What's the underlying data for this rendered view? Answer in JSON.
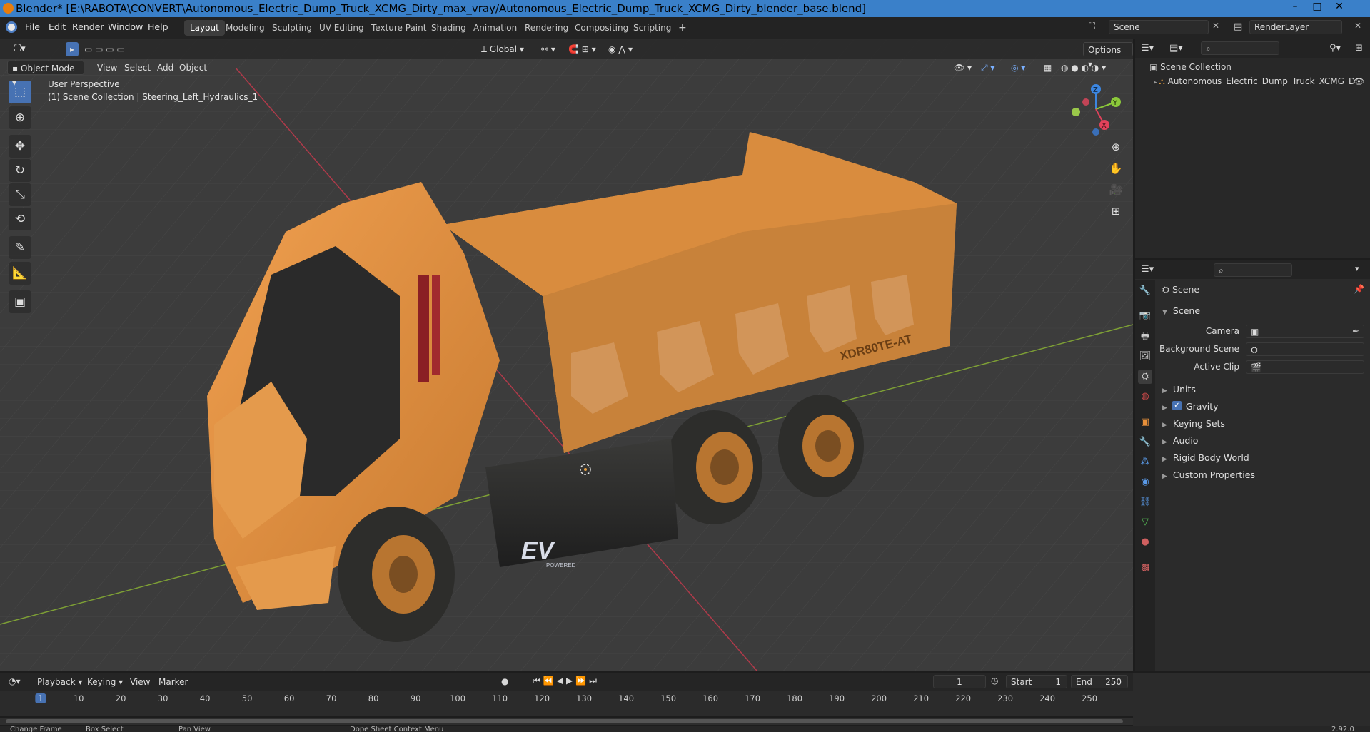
{
  "window": {
    "title": "Blender* [E:\\RABOTA\\CONVERT\\Autonomous_Electric_Dump_Truck_XCMG_Dirty_max_vray/Autonomous_Electric_Dump_Truck_XCMG_Dirty_blender_base.blend]",
    "controls": {
      "minimize": "–",
      "maximize": "□",
      "close": "✕"
    }
  },
  "menubar": {
    "items": [
      "File",
      "Edit",
      "Render",
      "Window",
      "Help"
    ]
  },
  "workspaces": {
    "tabs": [
      "Layout",
      "Modeling",
      "Sculpting",
      "UV Editing",
      "Texture Paint",
      "Shading",
      "Animation",
      "Rendering",
      "Compositing",
      "Scripting"
    ],
    "active": "Layout",
    "add": "+"
  },
  "scene_selector": {
    "value": "Scene"
  },
  "renderlayer_selector": {
    "value": "RenderLayer"
  },
  "viewport_header": {
    "mode": "Object Mode",
    "menus": [
      "View",
      "Select",
      "Add",
      "Object"
    ],
    "orientation": "Global",
    "options": "Options"
  },
  "viewport": {
    "perspective": "User Perspective",
    "collection_info": "(1) Scene Collection | Steering_Left_Hydraulics_1",
    "truck_label": "XDR80TE-AT",
    "ev_badge": "EV",
    "ev_sub": "POWERED"
  },
  "gizmo": {
    "x": "X",
    "y": "Y",
    "z": "Z"
  },
  "outliner": {
    "root": "Scene Collection",
    "items": [
      {
        "label": "Autonomous_Electric_Dump_Truck_XCMG_D"
      }
    ]
  },
  "properties": {
    "header_title": "Scene",
    "section": "Scene",
    "fields": {
      "camera": "Camera",
      "background_scene": "Background Scene",
      "active_clip": "Active Clip"
    },
    "panels": [
      "Units",
      "Gravity",
      "Keying Sets",
      "Audio",
      "Rigid Body World",
      "Custom Properties"
    ],
    "gravity_checked": true
  },
  "timeline": {
    "menus": [
      "Playback",
      "Keying",
      "View",
      "Marker"
    ],
    "current_frame": "1",
    "start_label": "Start",
    "start": "1",
    "end_label": "End",
    "end": "250",
    "ticks": [
      "1",
      "10",
      "20",
      "30",
      "40",
      "50",
      "60",
      "70",
      "80",
      "90",
      "100",
      "110",
      "120",
      "130",
      "140",
      "150",
      "160",
      "170",
      "180",
      "190",
      "200",
      "210",
      "220",
      "230",
      "240",
      "250"
    ]
  },
  "statusbar": {
    "items": [
      "Change Frame",
      "Box Select",
      "Pan View",
      "Dope Sheet Context Menu"
    ],
    "version": "2.92.0"
  },
  "colors": {
    "accent": "#4772b3",
    "titlebar": "#3a80c9",
    "truck": "#e08c3a",
    "x_axis": "#e3425b",
    "y_axis": "#8bc83a",
    "z_axis": "#3c86e0"
  }
}
